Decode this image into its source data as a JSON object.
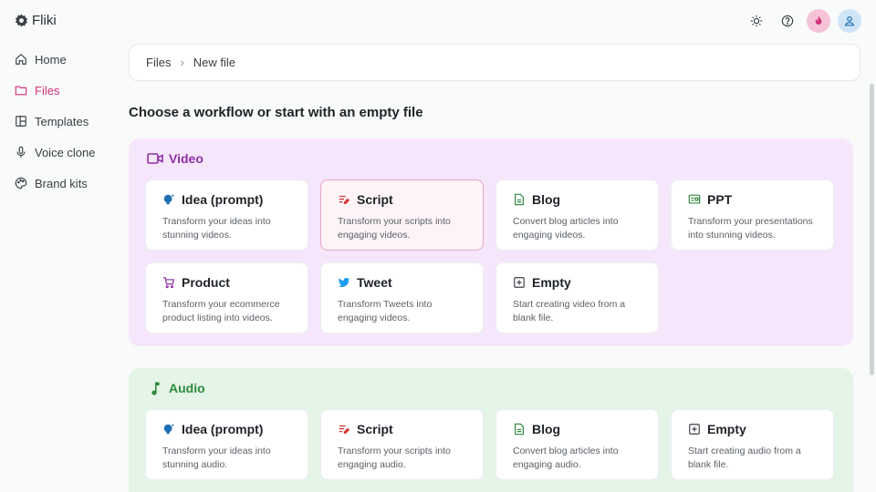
{
  "app": {
    "name": "Fliki"
  },
  "sidebar": {
    "items": [
      {
        "label": "Home",
        "icon": "home-icon"
      },
      {
        "label": "Files",
        "icon": "folder-icon",
        "active": true
      },
      {
        "label": "Templates",
        "icon": "templates-icon"
      },
      {
        "label": "Voice clone",
        "icon": "microphone-icon"
      },
      {
        "label": "Brand kits",
        "icon": "palette-icon"
      }
    ]
  },
  "breadcrumb": {
    "root": "Files",
    "current": "New file"
  },
  "heading": "Choose a workflow or start with an empty file",
  "video": {
    "title": "Video",
    "cards": [
      {
        "title": "Idea (prompt)",
        "desc": "Transform your ideas into stunning videos.",
        "icon": "lightbulb-icon"
      },
      {
        "title": "Script",
        "desc": "Transform your scripts into engaging videos.",
        "icon": "script-icon"
      },
      {
        "title": "Blog",
        "desc": "Convert blog articles into engaging videos.",
        "icon": "document-icon"
      },
      {
        "title": "PPT",
        "desc": "Transform your presentations into stunning videos.",
        "icon": "presentation-icon"
      },
      {
        "title": "Product",
        "desc": "Transform your ecommerce product listing into videos.",
        "icon": "cart-icon"
      },
      {
        "title": "Tweet",
        "desc": "Transform Tweets into engaging videos.",
        "icon": "twitter-icon"
      },
      {
        "title": "Empty",
        "desc": "Start creating video from a blank file.",
        "icon": "plus-box-icon"
      }
    ]
  },
  "audio": {
    "title": "Audio",
    "cards": [
      {
        "title": "Idea (prompt)",
        "desc": "Transform your ideas into stunning audio.",
        "icon": "lightbulb-icon"
      },
      {
        "title": "Script",
        "desc": "Transform your scripts into engaging audio.",
        "icon": "script-icon"
      },
      {
        "title": "Blog",
        "desc": "Convert blog articles into engaging audio.",
        "icon": "document-icon"
      },
      {
        "title": "Empty",
        "desc": "Start creating audio from a blank file.",
        "icon": "plus-box-icon"
      }
    ]
  },
  "colors": {
    "accent": "#d1327a",
    "video": "#8e2fa6",
    "audio": "#2f8a3f"
  }
}
